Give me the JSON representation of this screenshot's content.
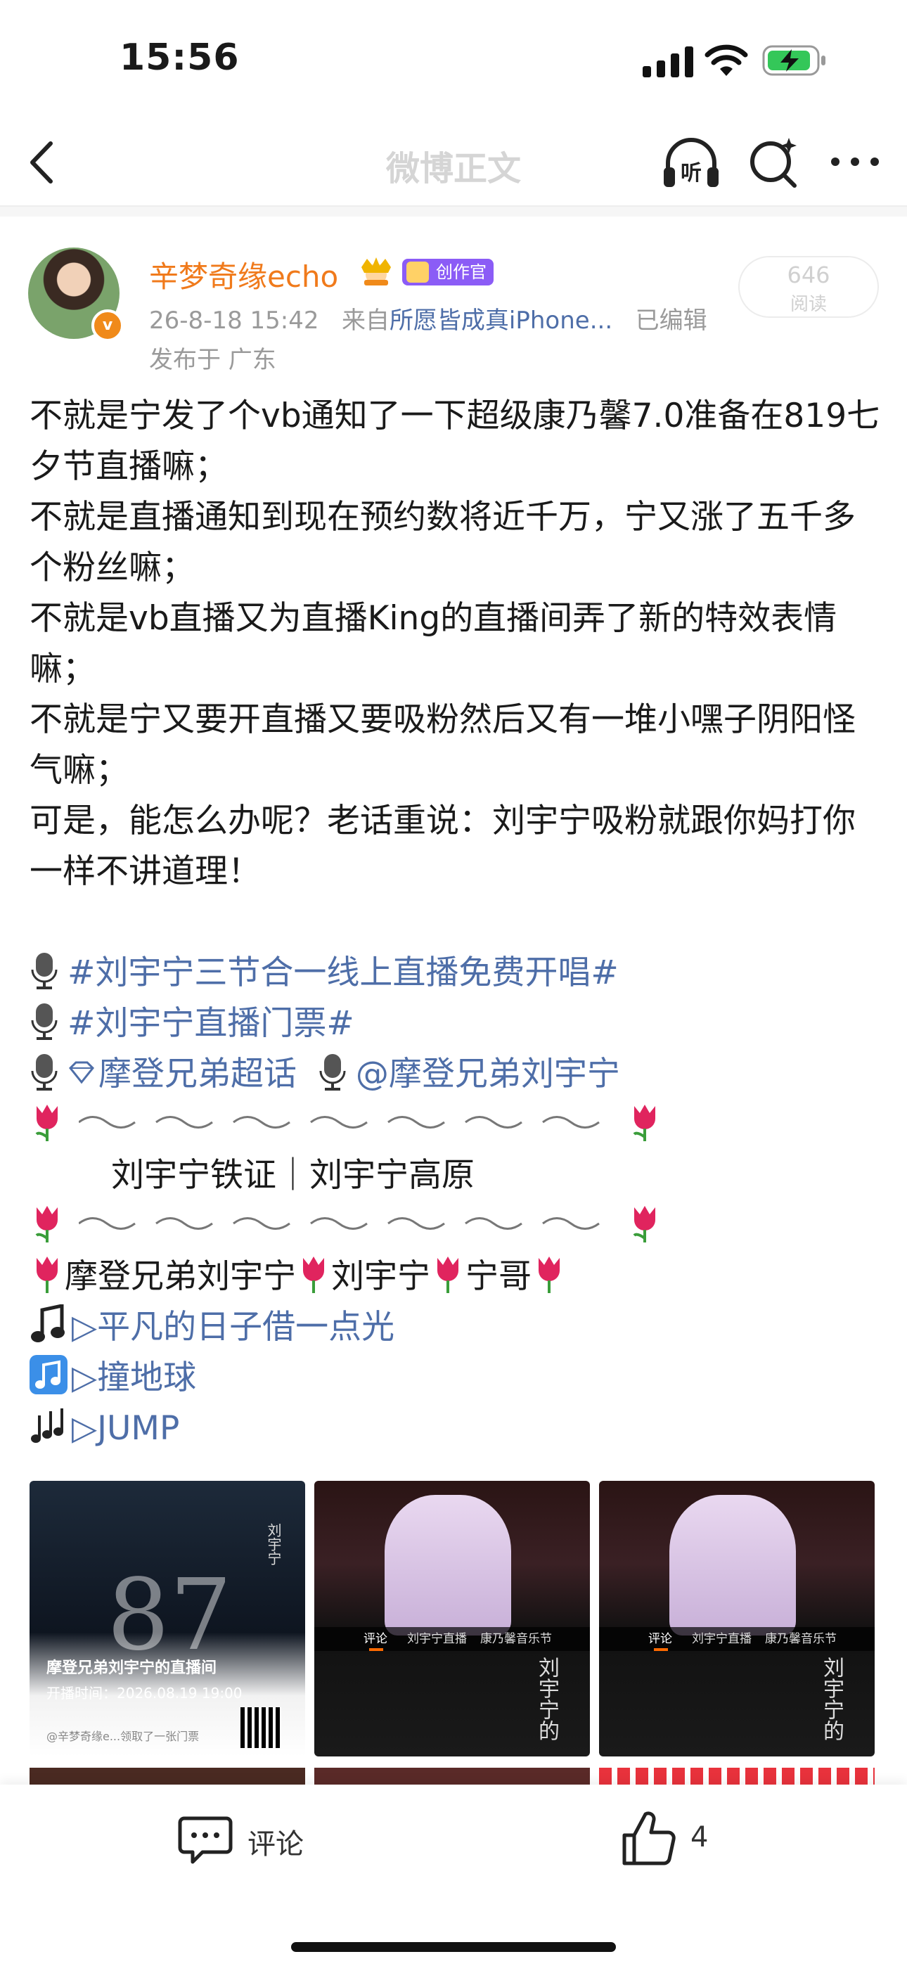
{
  "status_bar": {
    "time": "15:56"
  },
  "nav": {
    "title": "微博正文",
    "listen_label": "听"
  },
  "post": {
    "author": "辛梦奇缘echo",
    "creator_badge": "创作官",
    "verified_mark": "v",
    "meta": {
      "date": "26-8-18 15:42",
      "from_prefix": "来自",
      "source": "所愿皆成真iPhone...",
      "edited": "已编辑"
    },
    "location": "发布于 广东",
    "reads": {
      "count": "646",
      "label": "阅读"
    },
    "paragraphs": [
      "不就是宁发了个vb通知了一下超级康乃馨7.0准备在819七夕节直播嘛；",
      "不就是直播通知到现在预约数将近千万，宁又涨了五千多个粉丝嘛；",
      "不就是vb直播又为直播King的直播间弄了新的特效表情嘛；",
      "不就是宁又要开直播又要吸粉然后又有一堆小嘿子阴阳怪气嘛；",
      "可是，能怎么办呢？老话重说：刘宇宁吸粉就跟你妈打你一样不讲道理！"
    ],
    "topics": [
      "#刘宇宁三节合一线上直播免费开唱#",
      "#刘宇宁直播门票#"
    ],
    "supertopic": "摩登兄弟超话",
    "mention": "@摩登兄弟刘宇宁",
    "motto": "刘宇宁铁证｜刘宇宁高原",
    "names": [
      "摩登兄弟刘宇宁",
      "刘宇宁",
      "宁哥"
    ],
    "songs": [
      "▷平凡的日子借一点光",
      "▷撞地球",
      "▷JUMP"
    ]
  },
  "images": {
    "ticket": {
      "title": "摩登兄弟刘宇宁的直播间",
      "time": "开播时间：2026.08.19 19:00",
      "footer": "@辛梦奇缘e...领取了一张门票",
      "big_text": "87",
      "side_name": "刘宇宁"
    },
    "live_tabs": [
      "评论",
      "刘宇宁直播",
      "康乃馨音乐节"
    ],
    "live_vertical_text": "刘宇宁的"
  },
  "bottom_bar": {
    "comment_label": "评论",
    "like_count": "4"
  },
  "colors": {
    "username": "#f07a1b",
    "link": "#4e6ea8",
    "meta": "#9a9a9a",
    "creator_badge": "#8b5cf6"
  }
}
